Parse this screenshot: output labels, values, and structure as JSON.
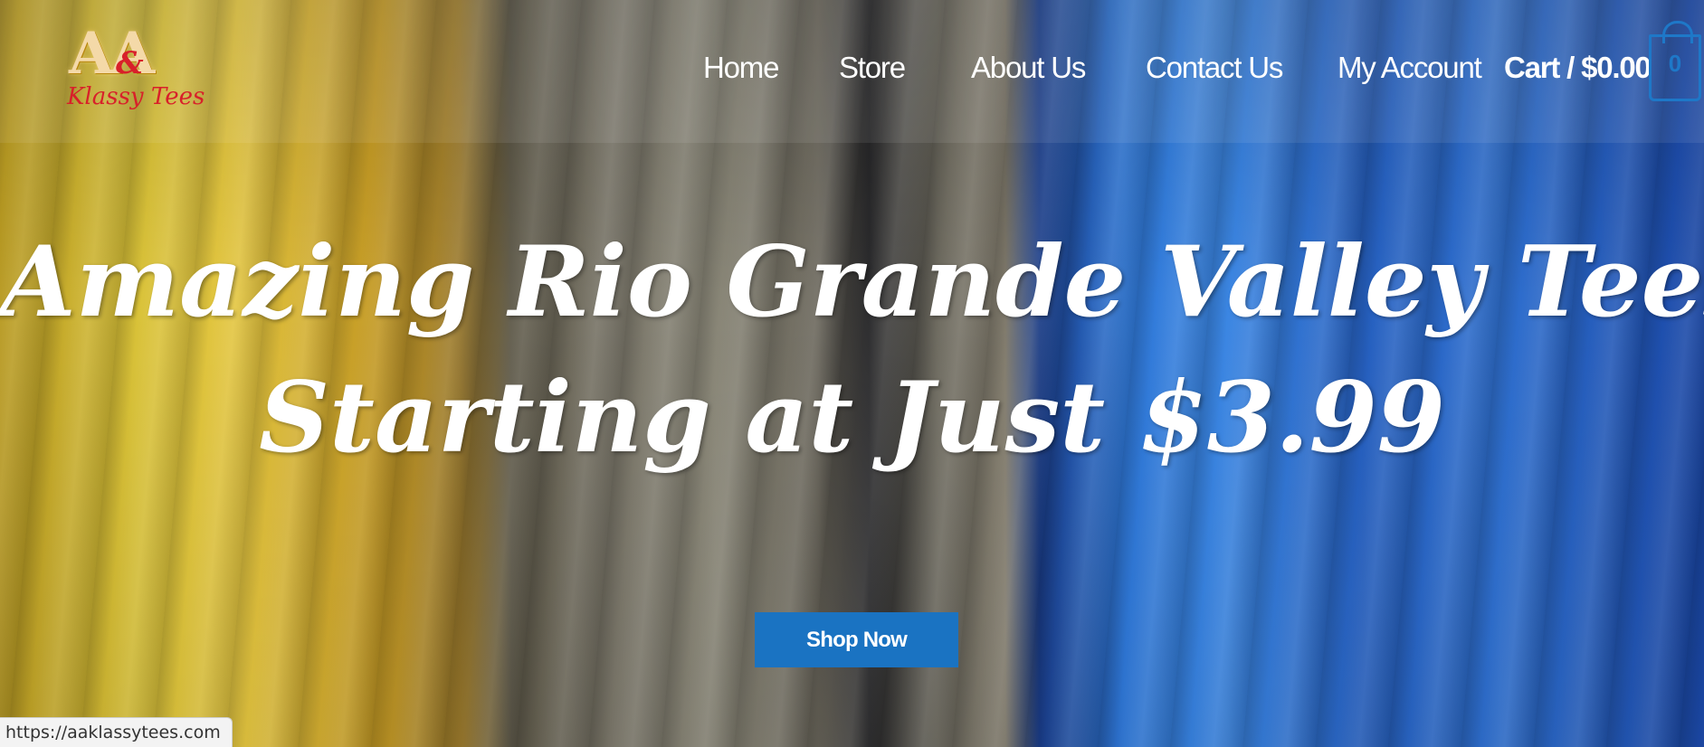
{
  "logo": {
    "mark": "AA",
    "amp": "&",
    "text": "Klassy Tees"
  },
  "nav": {
    "items": [
      {
        "label": "Home"
      },
      {
        "label": "Store"
      },
      {
        "label": "About Us"
      },
      {
        "label": "Contact Us"
      },
      {
        "label": "My Account"
      }
    ],
    "cart_label": "Cart / $0.00",
    "cart_count": "0"
  },
  "hero": {
    "line1": "Amazing Rio Grande Valley Tees",
    "line2": "Starting at Just $3.99",
    "button_label": "Shop Now"
  },
  "status_bar": {
    "url": "https://aaklassytees.com"
  },
  "colors": {
    "accent": "#1a73c2",
    "logo_red": "#d8202a",
    "logo_gold": "#f4d9a8"
  }
}
